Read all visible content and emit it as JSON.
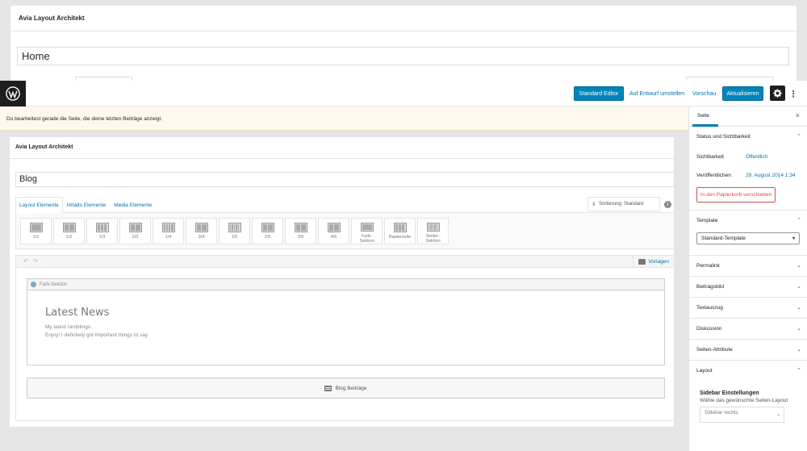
{
  "background": {
    "panel_title": "Avia Layout Architekt",
    "page_title_value": "Home"
  },
  "toolbar": {
    "standard_editor": "Standard Editor",
    "switch_draft": "Auf Entwurf umstellen",
    "preview": "Vorschau",
    "update": "Aktualisieren",
    "more": "⋮"
  },
  "notice": {
    "text": "Du bearbeitest gerade die Seite, die deine letzten Beiträge anzeigt."
  },
  "editor": {
    "panel_title": "Avia Layout Architekt",
    "title_value": "Blog",
    "tabs": [
      "Layout Elemente",
      "Inhalts Elemente",
      "Media Elemente"
    ],
    "sort_label": "Sortierung: Standard",
    "elements": [
      {
        "label": "1/1",
        "cols": 1
      },
      {
        "label": "1/2",
        "cols": 2
      },
      {
        "label": "1/3",
        "cols": 3
      },
      {
        "label": "2/3",
        "cols": 2
      },
      {
        "label": "1/4",
        "cols": 4
      },
      {
        "label": "3/4",
        "cols": 2
      },
      {
        "label": "1/5",
        "cols": 5
      },
      {
        "label": "2/5",
        "cols": 2
      },
      {
        "label": "3/5",
        "cols": 2
      },
      {
        "label": "4/5",
        "cols": 2
      },
      {
        "label": "Farb-\nSektion",
        "cols": 1
      },
      {
        "label": "Rasterzeile",
        "cols": 3
      },
      {
        "label": "Reiter-\nSektion",
        "cols": 5
      }
    ],
    "templates_label": "Vorlagen",
    "section_label": "Farb-Sektion",
    "section_heading": "Latest News",
    "section_text_1": "My latest ramblings.",
    "section_text_2": "Enjoy! I definitely got important things to say",
    "blog_entries": "Blog Beiträge"
  },
  "sidebar": {
    "tab_label": "Seite",
    "close": "×",
    "status_title": "Status und Sichtbarkeit",
    "visibility_label": "Sichtbarkeit",
    "visibility_value": "Öffentlich",
    "published_label": "Veröffentlichen",
    "published_value": "29. August 2014 1:34",
    "trash_button": "In den Papierkorb verschieben",
    "template_title": "Template",
    "template_value": "Standard-Template",
    "sections": [
      "Permalink",
      "Beitragsbild",
      "Textauszug",
      "Diskussion",
      "Seiten-Attribute"
    ],
    "layout_title": "Layout",
    "sidebar_settings_title": "Sidebar Einstellungen",
    "sidebar_settings_sub": "Wähle das gewünschte Seiten-Layout",
    "sidebar_value": "Sidebar rechts"
  },
  "colors": {
    "primary": "#0085ba",
    "link": "#0073aa",
    "danger": "#d94f4f",
    "notice_bg": "#fef8ee"
  }
}
